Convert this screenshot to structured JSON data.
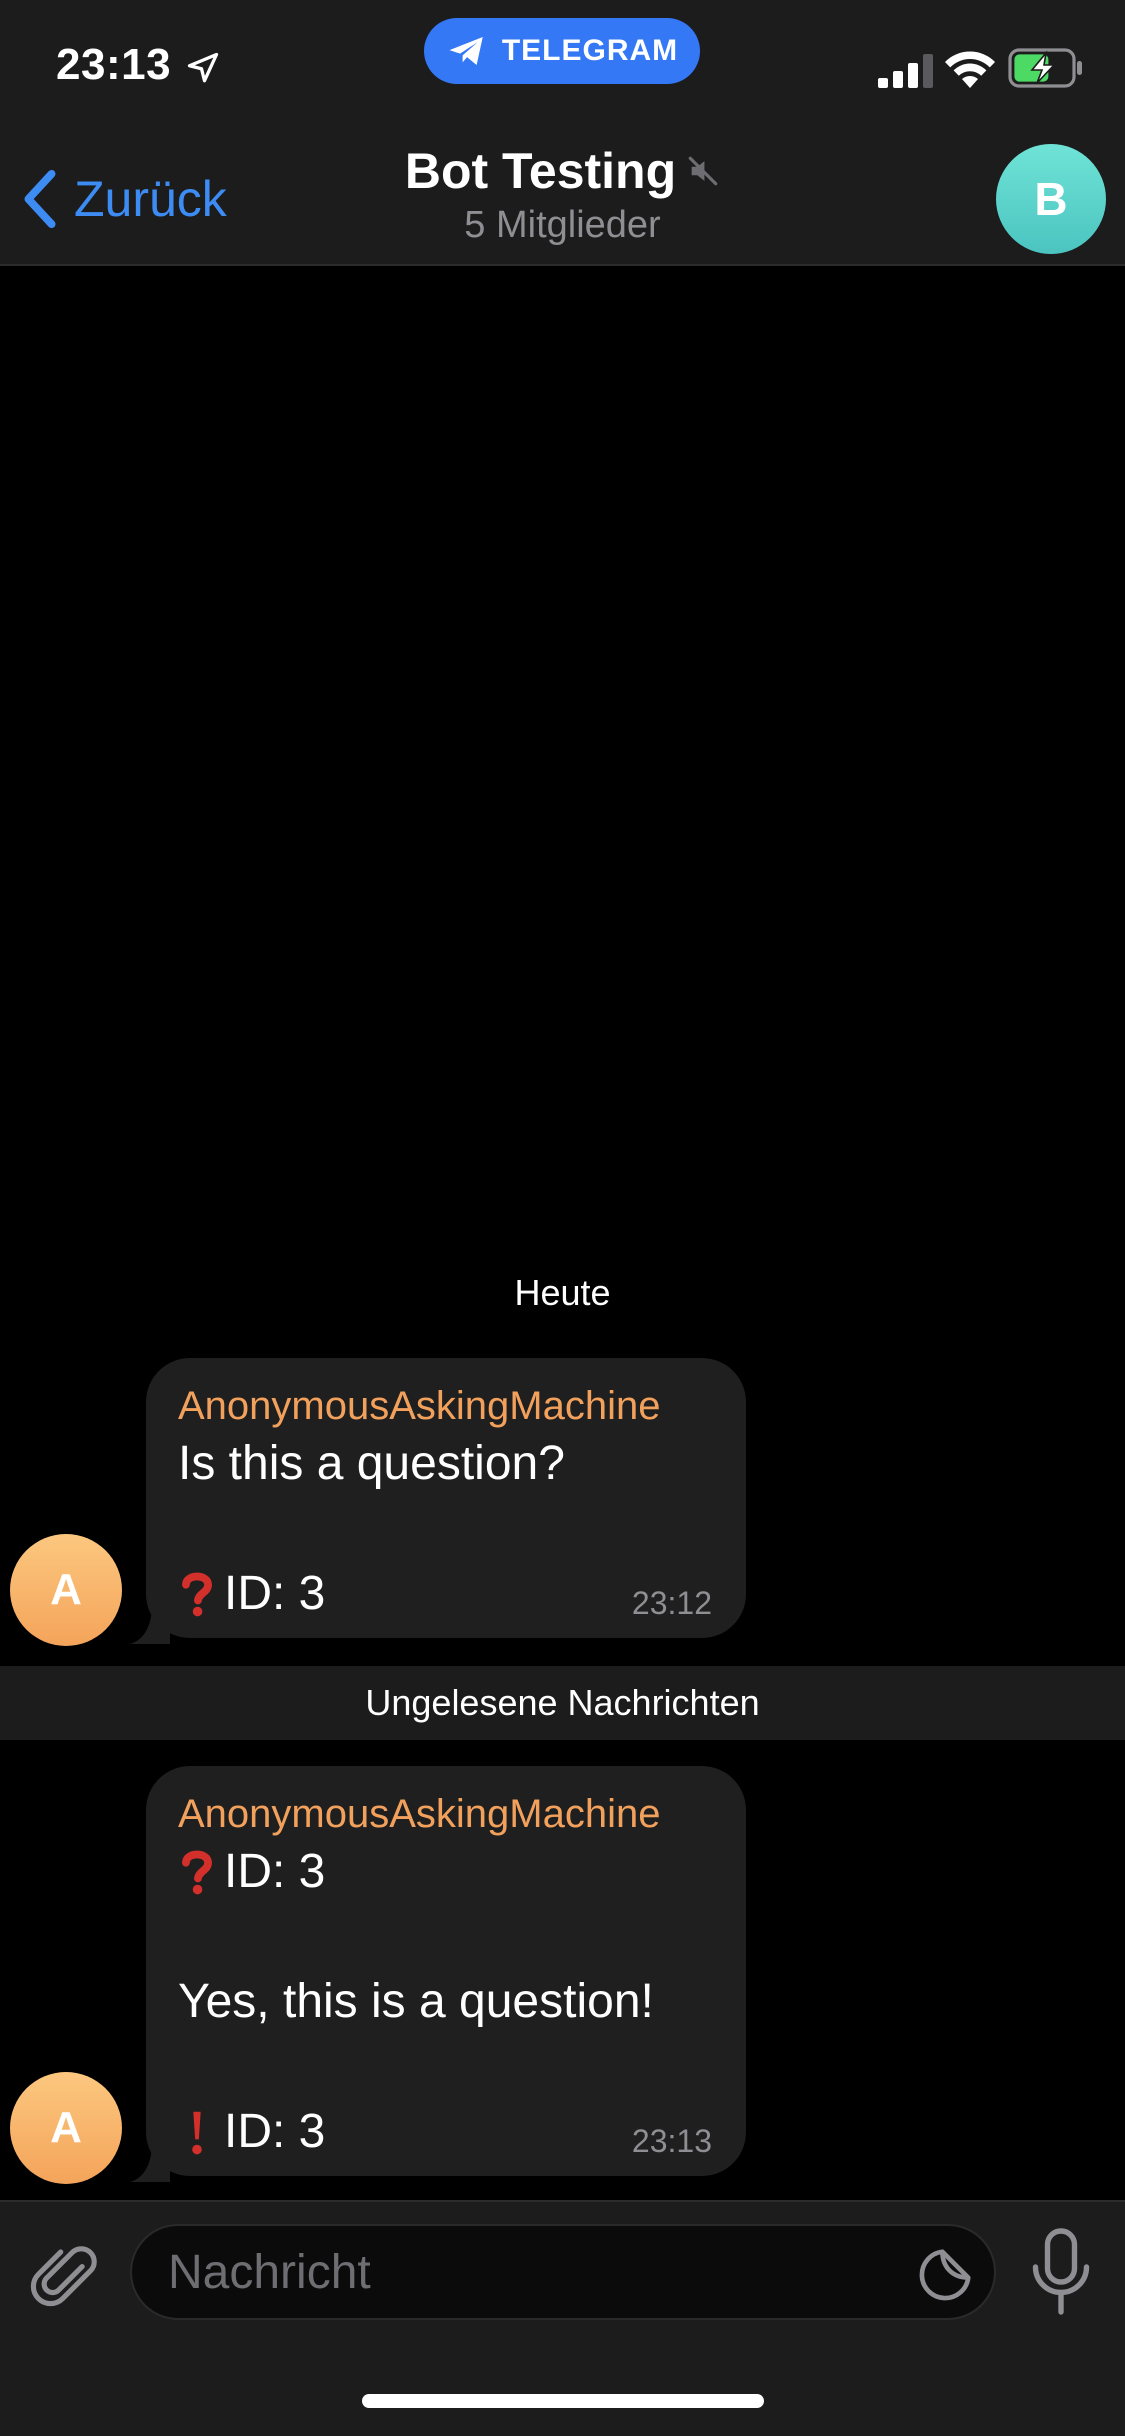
{
  "status_bar": {
    "time": "23:13",
    "app_pill_label": "TELEGRAM",
    "icons": [
      "location-arrow-icon",
      "telegram-icon",
      "signal-icon",
      "wifi-icon",
      "battery-charging-icon"
    ],
    "battery_color": "#4cd964"
  },
  "header": {
    "back_label": "Zurück",
    "title": "Bot Testing",
    "subtitle": "5 Mitglieder",
    "avatar_letter": "B",
    "accent_color": "#3d8cf4",
    "avatar_color": "#5fd4cc"
  },
  "chat": {
    "date_label": "Heute",
    "unread_label": "Ungelesene Nachrichten",
    "messages": [
      {
        "sender": "AnonymousAskingMachine",
        "avatar_letter": "A",
        "text": "Is this a question?",
        "id_text": "ID: 3",
        "id_icon": "question-mark-icon",
        "time": "23:12"
      },
      {
        "sender": "AnonymousAskingMachine",
        "avatar_letter": "A",
        "quote_id_text": "ID: 3",
        "quote_icon": "question-mark-icon",
        "text": "Yes, this is a question!",
        "id_text": "ID: 3",
        "id_icon": "exclamation-mark-icon",
        "time": "23:13"
      }
    ]
  },
  "input_bar": {
    "placeholder": "Nachricht",
    "icons": [
      "paperclip-icon",
      "sticker-icon",
      "microphone-icon"
    ]
  }
}
